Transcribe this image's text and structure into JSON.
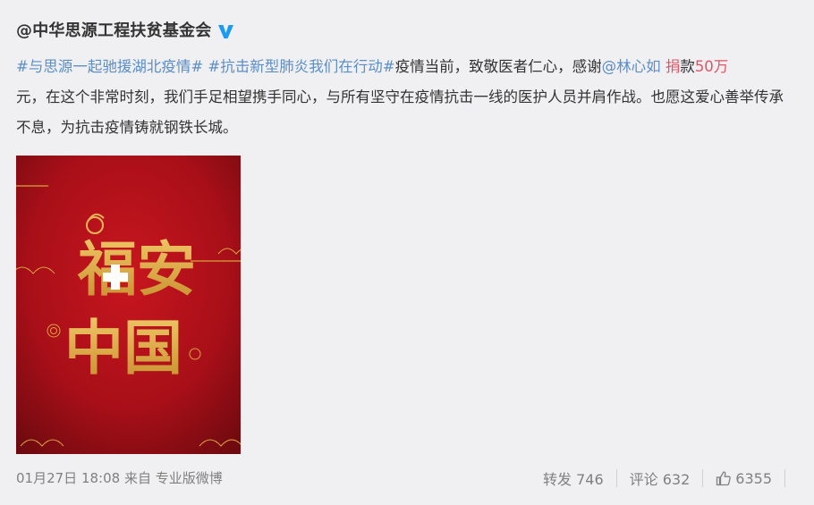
{
  "author": {
    "name": "@中华思源工程扶贫基金会",
    "verified_icon": "verified-v-icon",
    "verified_color": "#1b9cf4"
  },
  "post": {
    "hashtag1": "#与思源一起驰援湖北疫情#",
    "hashtag2": "#抗击新型肺炎我们在行动#",
    "text_part1": "疫情当前，致敬医者仁心，感谢",
    "mention": "@林心如",
    "donate_word": "捐",
    "text_part2": "款",
    "amount": "50万",
    "text_part3": "元，在这个非常时刻，我们手足相望携手同心，与所有坚守在疫情抗击一线的医护人员并肩作战。也愿这爱心善举传承不息，为抗击疫情铸就钢铁长城。"
  },
  "image": {
    "line1": "福安",
    "line2": "中国",
    "bg_color": "#b5121b",
    "text_color": "#d9a441"
  },
  "footer": {
    "timestamp": "01月27日 18:08 来自 专业版微博",
    "repost_label": "转发 746",
    "comment_label": "评论 632",
    "like_count": "6355"
  },
  "colors": {
    "link": "#5b8ec5",
    "highlight": "#e05565",
    "muted": "#808080",
    "text": "#333333"
  }
}
